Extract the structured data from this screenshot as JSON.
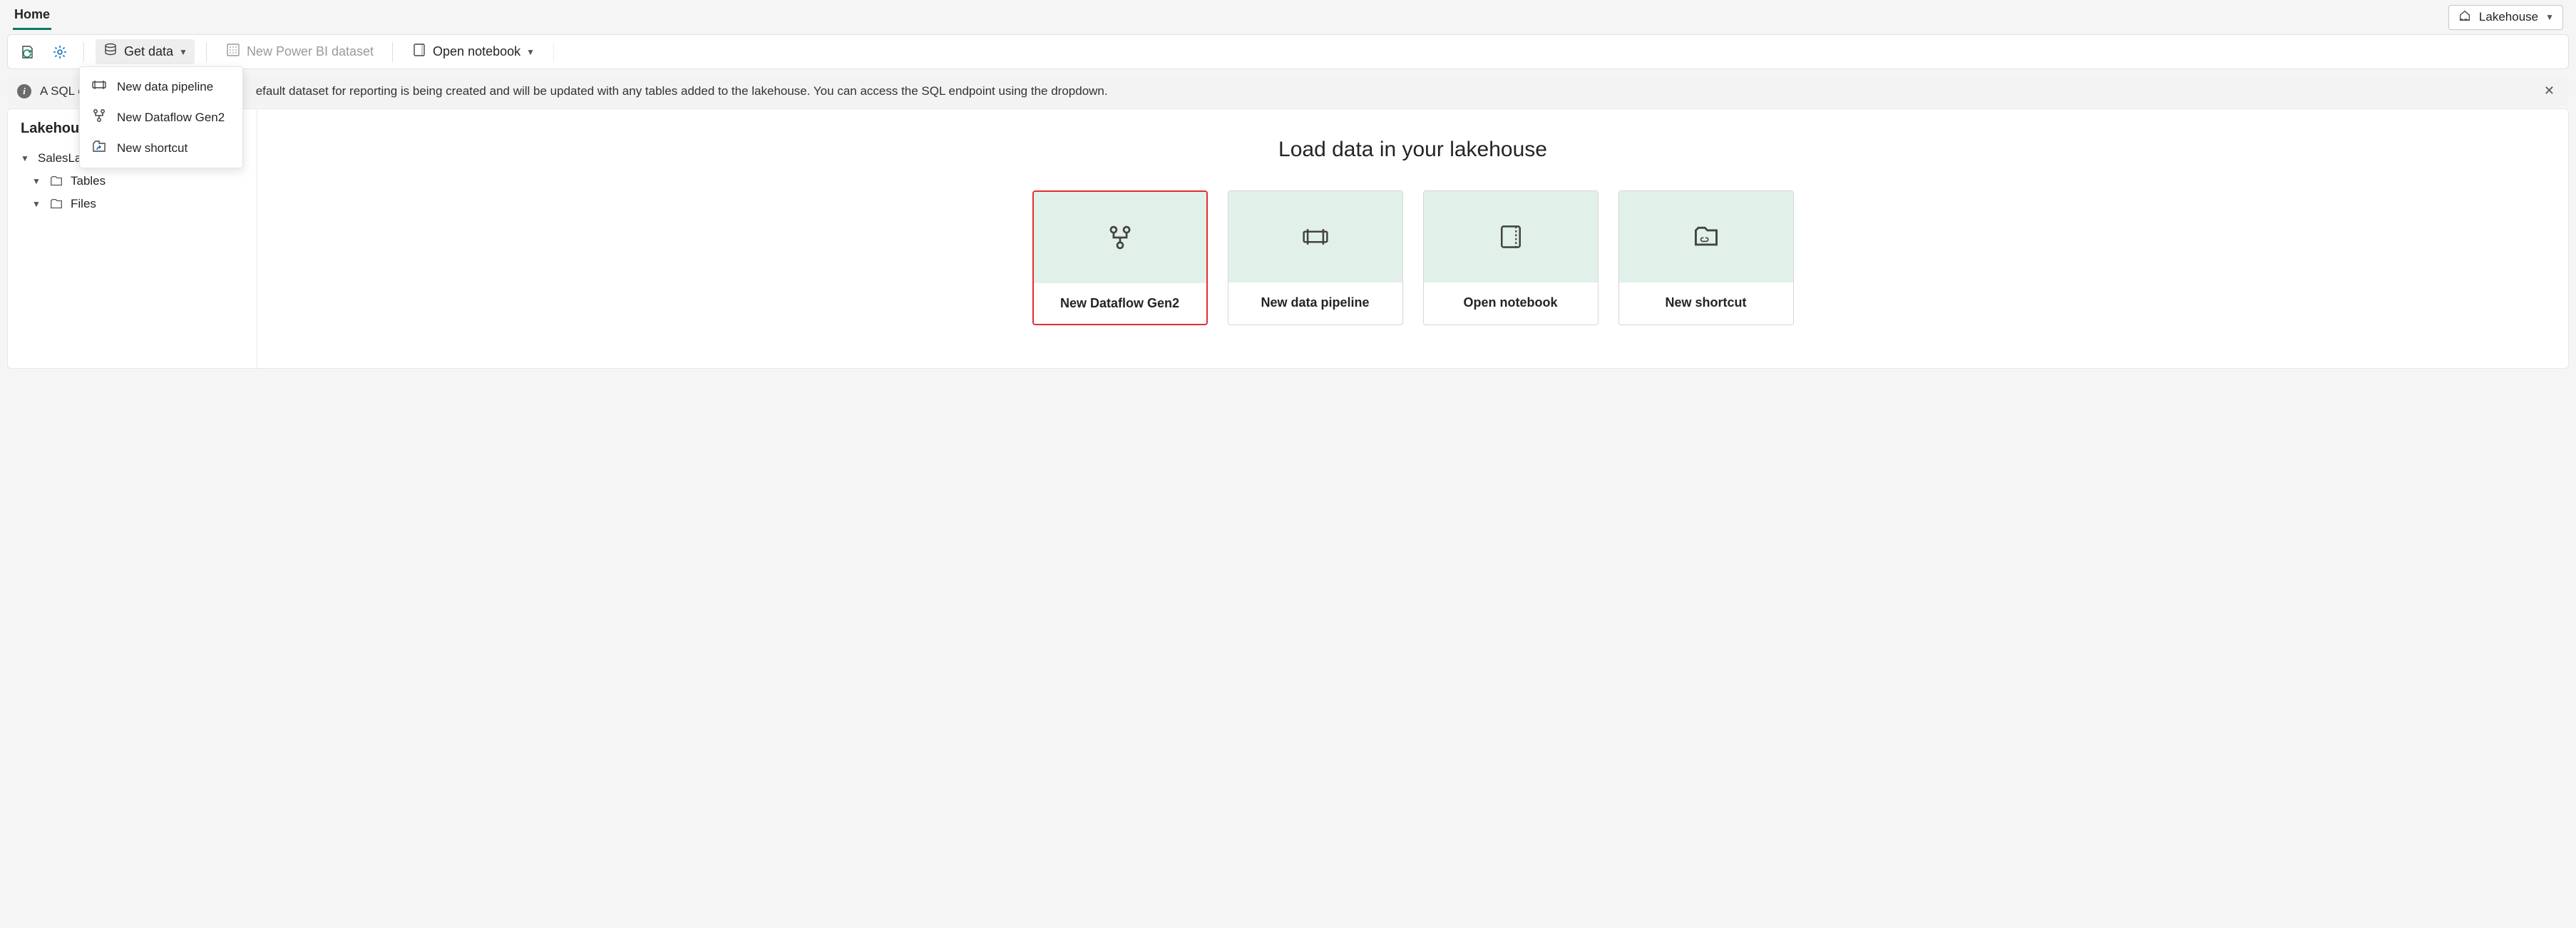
{
  "nav": {
    "homeTab": "Home",
    "modeLabel": "Lakehouse"
  },
  "toolbar": {
    "getData": "Get data",
    "newPbi": "New Power BI dataset",
    "openNb": "Open notebook"
  },
  "dropdown": {
    "pipeline": "New data pipeline",
    "dataflow": "New Dataflow Gen2",
    "shortcut": "New shortcut"
  },
  "info": {
    "msgPrefix": "A SQL e",
    "msgTail": "efault dataset for reporting is being created and will be updated with any tables added to the lakehouse. You can access the SQL endpoint using the dropdown."
  },
  "explorer": {
    "title": "Lakehous",
    "root": "SalesLakehouse",
    "tables": "Tables",
    "files": "Files"
  },
  "main": {
    "heading": "Load data in your lakehouse",
    "cards": {
      "dataflow": "New Dataflow Gen2",
      "pipeline": "New data pipeline",
      "notebook": "Open notebook",
      "shortcut": "New shortcut"
    }
  }
}
